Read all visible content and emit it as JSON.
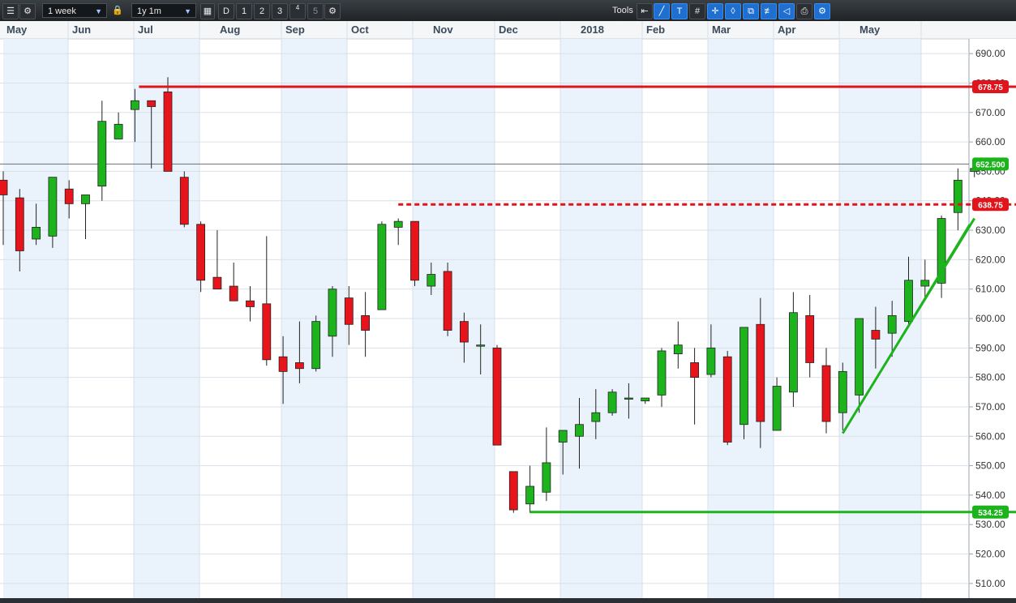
{
  "toolbar": {
    "menu_icon": "list-icon",
    "settings_icon": "gear-icon",
    "interval": "1 week",
    "lock_icon": "lock-icon",
    "range": "1y 1m",
    "calendar_icon": "calendar-icon",
    "period_buttons": [
      "D",
      "1",
      "2",
      "3",
      "4",
      "5"
    ],
    "gear2_icon": "gear-icon",
    "tools_label": "Tools"
  },
  "colors": {
    "up": "#1db31d",
    "down": "#e8141b",
    "resistance": "#e0141b",
    "support": "#1db31d",
    "band": "#eaf3fb",
    "grid": "#d8e0e8"
  },
  "chart_data": {
    "type": "candlestick",
    "ylim": [
      505,
      695
    ],
    "y_ticks": [
      "510.00",
      "520.00",
      "530.00",
      "540.00",
      "550.00",
      "560.00",
      "570.00",
      "580.00",
      "590.00",
      "600.00",
      "610.00",
      "620.00",
      "630.00",
      "640.00",
      "650.00",
      "660.00",
      "670.00",
      "680.00",
      "690.00"
    ],
    "month_labels": [
      "May",
      "Jun",
      "Jul",
      "Aug",
      "Sep",
      "Oct",
      "Nov",
      "Dec",
      "2018",
      "Feb",
      "Mar",
      "Apr",
      "May"
    ],
    "current_price": "652.500",
    "levels": [
      {
        "label": "678.75",
        "value": 678.75,
        "style": "solid",
        "color": "#e0141b"
      },
      {
        "label": "638.75",
        "value": 638.75,
        "style": "dashed",
        "color": "#e0141b"
      },
      {
        "label": "534.25",
        "value": 534.25,
        "style": "solid",
        "color": "#1db31d"
      }
    ],
    "candles": [
      [
        647,
        650,
        625,
        642
      ],
      [
        641,
        644,
        616,
        623
      ],
      [
        627,
        639,
        625,
        631
      ],
      [
        628,
        648,
        624,
        648
      ],
      [
        644,
        647,
        634,
        639
      ],
      [
        639,
        641,
        627,
        642
      ],
      [
        645,
        674,
        640,
        667
      ],
      [
        661,
        670,
        661,
        666
      ],
      [
        671,
        678,
        660,
        674
      ],
      [
        674,
        674,
        651,
        672
      ],
      [
        677,
        682,
        650,
        650
      ],
      [
        648,
        650,
        631,
        632
      ],
      [
        632,
        633,
        609,
        613
      ],
      [
        614,
        630,
        610,
        610
      ],
      [
        611,
        619,
        607,
        606
      ],
      [
        606,
        611,
        599,
        604
      ],
      [
        605,
        628,
        584,
        586
      ],
      [
        587,
        594,
        571,
        582
      ],
      [
        585,
        599,
        578,
        583
      ],
      [
        583,
        601,
        582,
        599
      ],
      [
        594,
        611,
        587,
        610
      ],
      [
        607,
        611,
        591,
        598
      ],
      [
        601,
        609,
        587,
        596
      ],
      [
        603,
        633,
        603,
        632
      ],
      [
        631,
        634,
        625,
        633
      ],
      [
        633,
        633,
        611,
        613
      ],
      [
        611,
        619,
        608,
        615
      ],
      [
        616,
        619,
        594,
        596
      ],
      [
        599,
        602,
        585,
        592
      ],
      [
        591,
        598,
        581,
        591
      ],
      [
        590,
        591,
        558,
        557
      ],
      [
        548,
        548,
        534,
        535
      ],
      [
        537,
        550,
        534,
        543
      ],
      [
        541,
        563,
        538,
        551
      ],
      [
        558,
        562,
        547,
        562
      ],
      [
        560,
        573,
        549,
        564
      ],
      [
        565,
        576,
        559,
        568
      ],
      [
        568,
        576,
        567,
        575
      ],
      [
        573,
        578,
        566,
        573
      ],
      [
        572,
        572,
        571,
        573
      ],
      [
        574,
        590,
        570,
        589
      ],
      [
        588,
        599,
        583,
        591
      ],
      [
        585,
        590,
        564,
        580
      ],
      [
        581,
        598,
        580,
        590
      ],
      [
        587,
        589,
        557,
        558
      ],
      [
        564,
        597,
        559,
        597
      ],
      [
        598,
        607,
        556,
        565
      ],
      [
        562,
        580,
        562,
        577
      ],
      [
        575,
        609,
        570,
        602
      ],
      [
        601,
        608,
        580,
        585
      ],
      [
        584,
        590,
        561,
        565
      ],
      [
        568,
        585,
        562,
        582
      ],
      [
        574,
        600,
        568,
        600
      ],
      [
        596,
        604,
        583,
        593
      ],
      [
        595,
        606,
        587,
        601
      ],
      [
        599,
        621,
        598,
        613
      ],
      [
        611,
        620,
        607,
        613
      ],
      [
        612,
        635,
        607,
        634
      ],
      [
        636,
        651,
        630,
        647
      ],
      [
        650,
        652,
        648,
        651
      ]
    ],
    "trendline": {
      "from": {
        "candle": 51,
        "value": 561
      },
      "to": {
        "candle": 59,
        "value": 634
      }
    }
  }
}
